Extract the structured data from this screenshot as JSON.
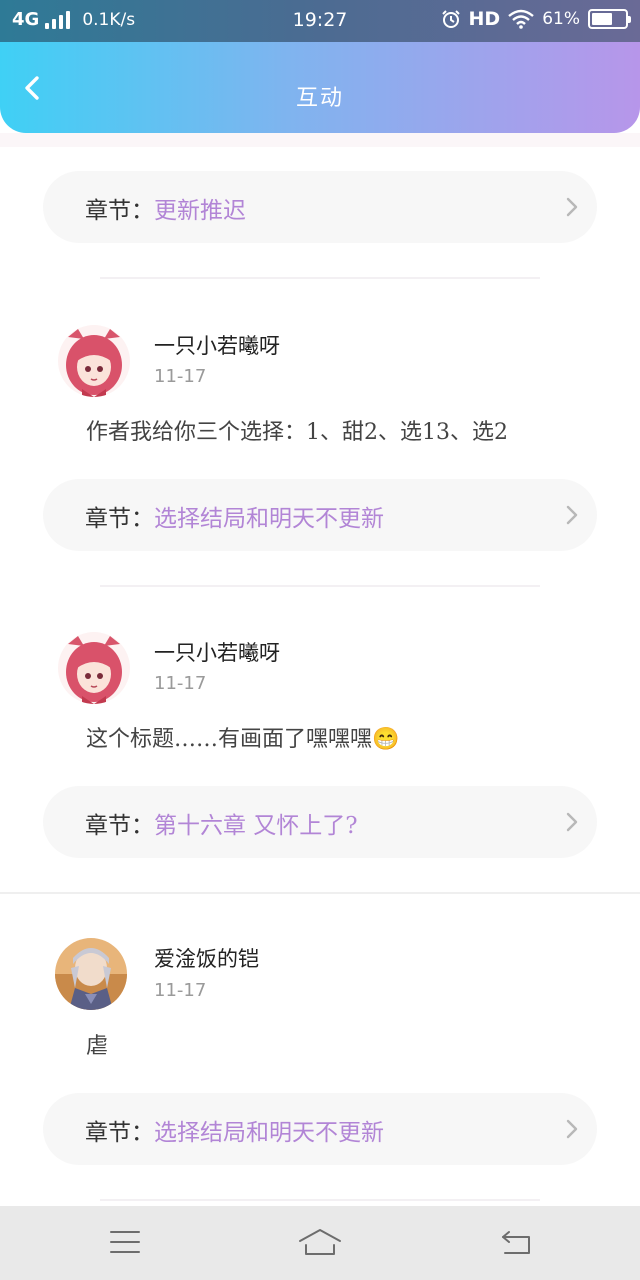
{
  "status_bar": {
    "network": "4G",
    "speed": "0.1K/s",
    "time": "19:27",
    "hd": "HD",
    "battery_text": "61%",
    "battery_level": 0.61
  },
  "header": {
    "title": "互动",
    "back_icon": "chevron-left-icon"
  },
  "chapter_label": "章节：",
  "top_chapter": {
    "title": "更新推迟"
  },
  "comments": [
    {
      "username": "一只小若曦呀",
      "date": "11-17",
      "text": "作者我给你三个选择：1、甜2、选13、选2",
      "chapter": "选择结局和明天不更新"
    },
    {
      "username": "一只小若曦呀",
      "date": "11-17",
      "text": "这个标题……有画面了嘿嘿嘿😁",
      "chapter": "第十六章 又怀上了?"
    },
    {
      "username": "爱淦饭的铠",
      "date": "11-17",
      "text": "虐",
      "chapter": "选择结局和明天不更新"
    }
  ],
  "colors": {
    "accent_purple": "#b285d6",
    "header_gradient_start": "#3fd0f5",
    "header_gradient_end": "#b796ea"
  },
  "nav": {
    "menu_icon": "menu-icon",
    "home_icon": "home-icon",
    "back_icon": "back-icon"
  }
}
